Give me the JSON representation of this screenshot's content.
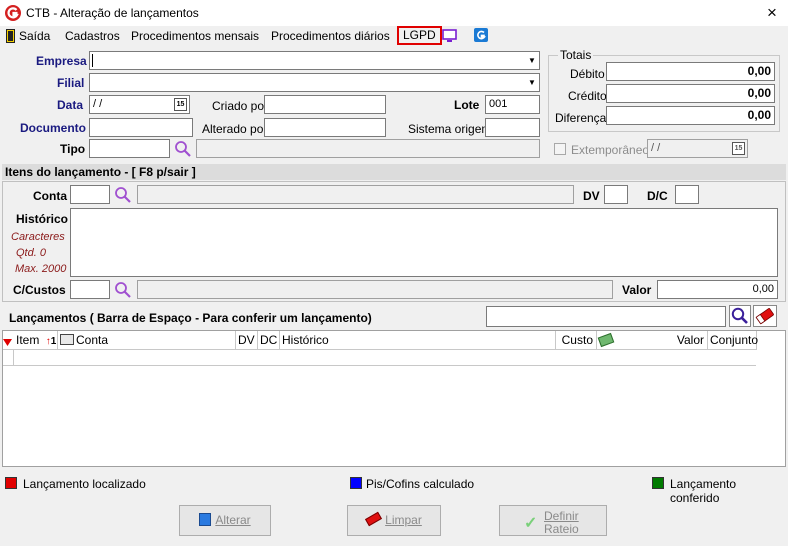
{
  "window": {
    "title": "CTB - Alteração de lançamentos",
    "close_icon": "×"
  },
  "menu": {
    "saida": "Saída",
    "cadastros": "Cadastros",
    "proc_mensais": "Procedimentos mensais",
    "proc_diarios": "Procedimentos diários",
    "lgpd": "LGPD"
  },
  "header": {
    "empresa_label": "Empresa",
    "filial_label": "Filial",
    "data_label": "Data",
    "data_value": " /  /",
    "criado_por_label": "Criado por",
    "lote_label": "Lote",
    "lote_value": "001",
    "documento_label": "Documento",
    "alterado_por_label": "Alterado por",
    "sistema_origem_label": "Sistema origem",
    "tipo_label": "Tipo",
    "extemporaneo_label": "Extemporâneo",
    "extemporaneo_date": " /  /",
    "calendar_icon_text": "15"
  },
  "totais": {
    "title": "Totais",
    "debito_label": "Débito",
    "debito_value": "0,00",
    "credito_label": "Crédito",
    "credito_value": "0,00",
    "diferenca_label": "Diferença",
    "diferenca_value": "0,00"
  },
  "itens": {
    "section_title": "Itens do lançamento - [ F8 p/sair ]",
    "conta_label": "Conta",
    "dv_label": "DV",
    "dc_label": "D/C",
    "historico_label": "Histórico",
    "caracteres": "Caracteres",
    "qtd": "Qtd. 0",
    "max": "Max. 2000",
    "ccustos_label": "C/Custos",
    "valor_label": "Valor",
    "valor_value": "0,00"
  },
  "lancamentos": {
    "title": "Lançamentos ( Barra de Espaço - Para conferir um lançamento)",
    "columns": {
      "item": "Item",
      "conta": "Conta",
      "dv": "DV",
      "dc": "DC",
      "historico": "Histórico",
      "custo": "Custo",
      "valor": "Valor",
      "conjunto": "Conjunto"
    },
    "sort_icon_text": "1"
  },
  "legend": {
    "localizado": "Lançamento localizado",
    "piscofins": "Pis/Cofins calculado",
    "conferido": "Lançamento conferido",
    "colors": {
      "localizado": "#e00000",
      "piscofins": "#0000ff",
      "conferido": "#007a00"
    }
  },
  "buttons": {
    "alterar": "Alterar",
    "limpar": "Limpar",
    "definir": "Definir",
    "rateio": "Rateio"
  }
}
